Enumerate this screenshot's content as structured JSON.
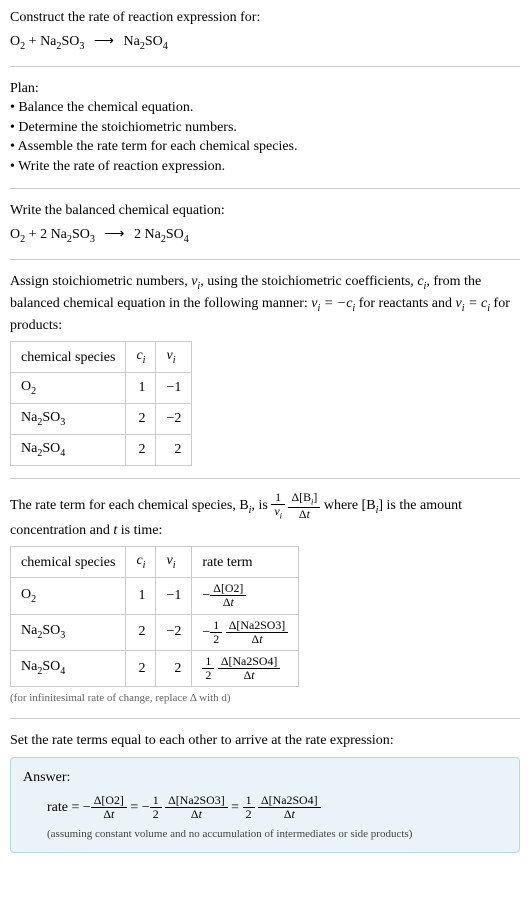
{
  "prompt": {
    "title": "Construct the rate of reaction expression for:",
    "equation": "O₂ + Na₂SO₃ ⟶ Na₂SO₄"
  },
  "plan": {
    "title": "Plan:",
    "items": [
      "• Balance the chemical equation.",
      "• Determine the stoichiometric numbers.",
      "• Assemble the rate term for each chemical species.",
      "• Write the rate of reaction expression."
    ]
  },
  "balanced": {
    "title": "Write the balanced chemical equation:",
    "equation": "O₂ + 2 Na₂SO₃ ⟶ 2 Na₂SO₄"
  },
  "stoich": {
    "intro_part1": "Assign stoichiometric numbers, ",
    "nu_i": "νᵢ",
    "intro_part2": ", using the stoichiometric coefficients, ",
    "c_i": "cᵢ",
    "intro_part3": ", from the balanced chemical equation in the following manner: ",
    "rule1": "νᵢ = −cᵢ",
    "intro_part4": " for reactants and ",
    "rule2": "νᵢ = cᵢ",
    "intro_part5": " for products:",
    "headers": {
      "species": "chemical species",
      "ci": "cᵢ",
      "nui": "νᵢ"
    },
    "rows": [
      {
        "species": "O₂",
        "ci": "1",
        "nui": "−1"
      },
      {
        "species": "Na₂SO₃",
        "ci": "2",
        "nui": "−2"
      },
      {
        "species": "Na₂SO₄",
        "ci": "2",
        "nui": "2"
      }
    ]
  },
  "rateterm": {
    "intro_part1": "The rate term for each chemical species, B",
    "intro_part2": ", is ",
    "intro_part3": " where [B",
    "intro_part4": "] is the amount concentration and ",
    "t": "t",
    "intro_part5": " is time:",
    "headers": {
      "species": "chemical species",
      "ci": "cᵢ",
      "nui": "νᵢ",
      "rate": "rate term"
    },
    "rows": [
      {
        "species": "O₂",
        "ci": "1",
        "nui": "−1",
        "rate_prefix": "−",
        "rate_coef": "",
        "rate_num": "Δ[O2]",
        "rate_den": "Δt"
      },
      {
        "species": "Na₂SO₃",
        "ci": "2",
        "nui": "−2",
        "rate_prefix": "−",
        "rate_coef_num": "1",
        "rate_coef_den": "2",
        "rate_num": "Δ[Na2SO3]",
        "rate_den": "Δt"
      },
      {
        "species": "Na₂SO₄",
        "ci": "2",
        "nui": "2",
        "rate_prefix": "",
        "rate_coef_num": "1",
        "rate_coef_den": "2",
        "rate_num": "Δ[Na2SO4]",
        "rate_den": "Δt"
      }
    ],
    "note": "(for infinitesimal rate of change, replace Δ with d)"
  },
  "final": {
    "title": "Set the rate terms equal to each other to arrive at the rate expression:"
  },
  "answer": {
    "label": "Answer:",
    "rate_label": "rate = ",
    "term1_sign": "−",
    "term1_num": "Δ[O2]",
    "term1_den": "Δt",
    "eq1": " = −",
    "term2_coef_num": "1",
    "term2_coef_den": "2",
    "term2_num": "Δ[Na2SO3]",
    "term2_den": "Δt",
    "eq2": " = ",
    "term3_coef_num": "1",
    "term3_coef_den": "2",
    "term3_num": "Δ[Na2SO4]",
    "term3_den": "Δt",
    "note": "(assuming constant volume and no accumulation of intermediates or side products)"
  }
}
